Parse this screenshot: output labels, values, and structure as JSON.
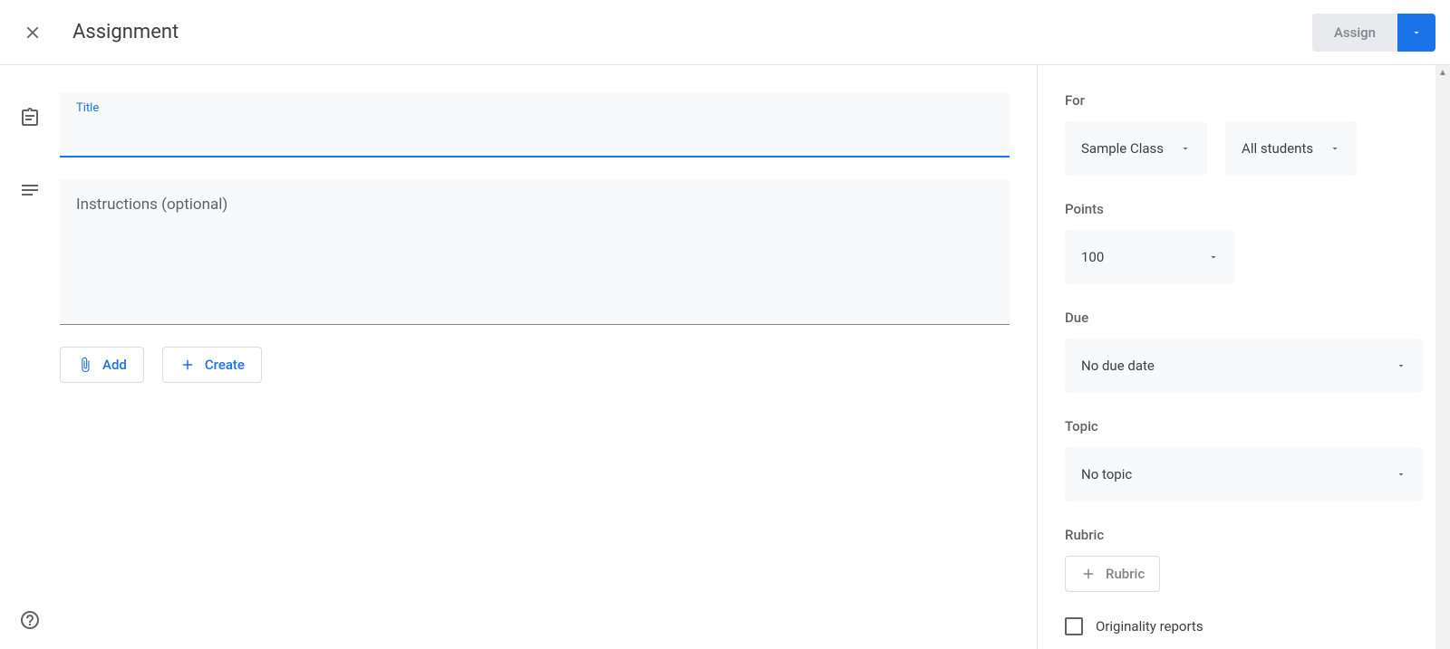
{
  "header": {
    "title": "Assignment",
    "assign_label": "Assign"
  },
  "main": {
    "title_label": "Title",
    "title_value": "",
    "instructions_placeholder": "Instructions (optional)",
    "instructions_value": "",
    "add_label": "Add",
    "create_label": "Create"
  },
  "sidebar": {
    "for_label": "For",
    "class_value": "Sample Class",
    "students_value": "All students",
    "points_label": "Points",
    "points_value": "100",
    "due_label": "Due",
    "due_value": "No due date",
    "topic_label": "Topic",
    "topic_value": "No topic",
    "rubric_label": "Rubric",
    "rubric_button": "Rubric",
    "originality_label": "Originality reports"
  }
}
